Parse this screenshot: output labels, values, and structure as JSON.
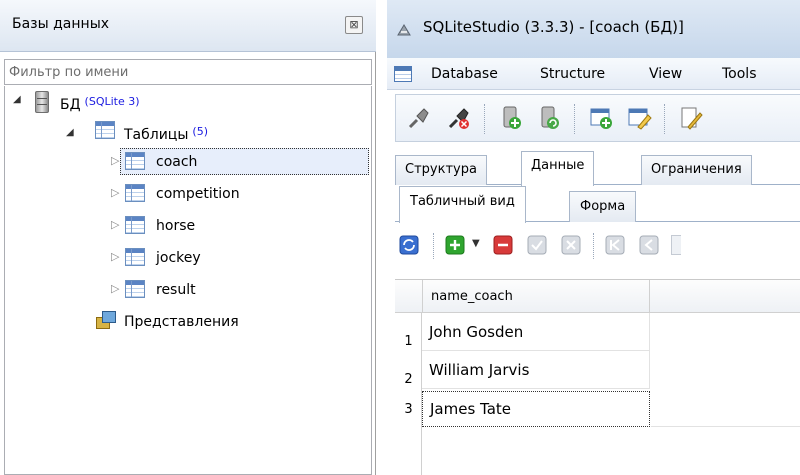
{
  "left_panel": {
    "title": "Базы данных",
    "close_glyph": "⊠",
    "filter_placeholder": "Фильтр по имени",
    "db": {
      "name": "БД",
      "type": "(SQLite 3)"
    },
    "tables_group": {
      "label": "Таблицы",
      "count": "(5)"
    },
    "tables": [
      "coach",
      "competition",
      "horse",
      "jockey",
      "result"
    ],
    "views_label": "Представления",
    "selected_table": "coach"
  },
  "window": {
    "title": "SQLiteStudio (3.3.3) - [coach (БД)]",
    "menu": [
      "Database",
      "Structure",
      "View",
      "Tools"
    ],
    "tabs": [
      "Структура",
      "Данные",
      "Ограничения"
    ],
    "active_tab": "Данные",
    "subtabs": [
      "Табличный вид",
      "Форма"
    ],
    "active_subtab": "Табличный вид"
  },
  "grid": {
    "columns": [
      "name_coach"
    ],
    "rows": [
      {
        "num": "1",
        "name_coach": "John Gosden"
      },
      {
        "num": "2",
        "name_coach": "William Jarvis"
      },
      {
        "num": "3",
        "name_coach": "James Tate"
      }
    ]
  },
  "colors": {
    "badge": "#1a1ae0",
    "selection_bg": "#e7eefb",
    "header_gradient": "#c6d7eb"
  }
}
